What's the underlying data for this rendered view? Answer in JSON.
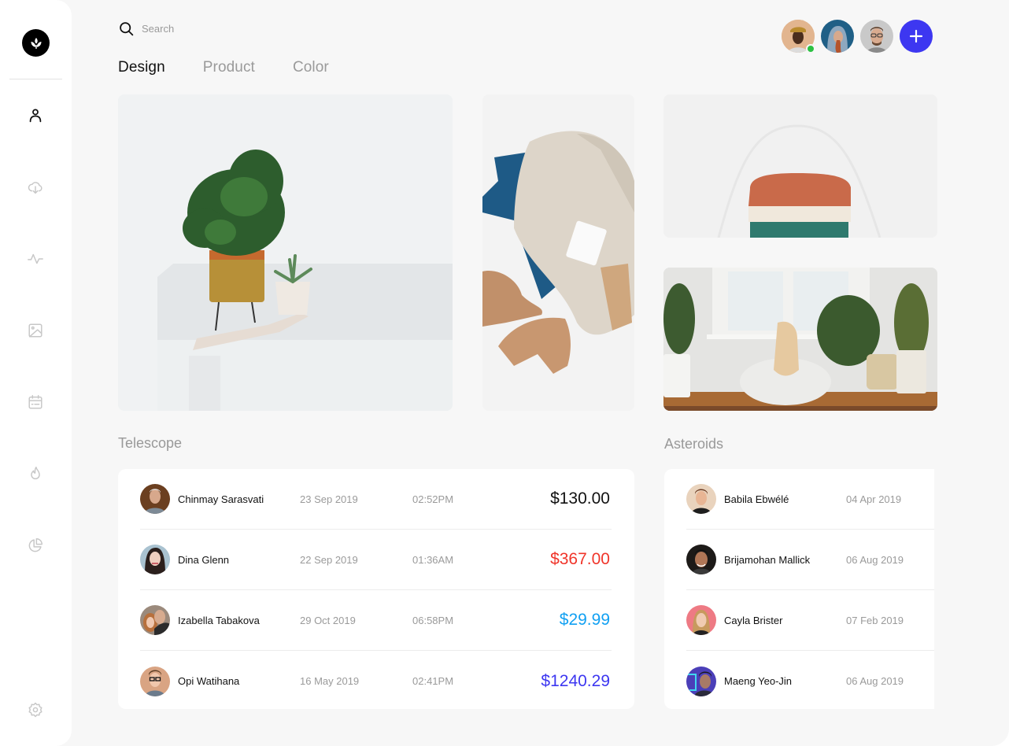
{
  "sidebar": {
    "logo": "leaf-logo-icon",
    "items": [
      {
        "icon": "user-icon",
        "active": true
      },
      {
        "icon": "cloud-download-icon",
        "active": false
      },
      {
        "icon": "activity-icon",
        "active": false
      },
      {
        "icon": "image-icon",
        "active": false
      },
      {
        "icon": "calendar-icon",
        "active": false
      },
      {
        "icon": "fire-icon",
        "active": false
      },
      {
        "icon": "pie-chart-icon",
        "active": false
      }
    ],
    "footer_icon": "settings-icon"
  },
  "search": {
    "placeholder": "Search",
    "value": ""
  },
  "tabs": [
    {
      "label": "Design",
      "active": true
    },
    {
      "label": "Product",
      "active": false
    },
    {
      "label": "Color",
      "active": false
    }
  ],
  "collaborators": [
    {
      "name": "collaborator-1",
      "online": true
    },
    {
      "name": "collaborator-2",
      "online": false
    },
    {
      "name": "collaborator-3",
      "online": false
    }
  ],
  "add_button_icon": "plus-icon",
  "gallery": [
    {
      "subject": "potted plants on white table"
    },
    {
      "subject": "jeans, sweater, boots and mug flat lay"
    },
    {
      "subject": "stacked knit sweaters"
    },
    {
      "subject": "dog on bed in plant-filled room"
    }
  ],
  "telescope": {
    "title": "Telescope",
    "rows": [
      {
        "name": "Chinmay Sarasvati",
        "date": "23 Sep 2019",
        "time": "02:52PM",
        "amount": "$130.00",
        "amount_color": "#111111"
      },
      {
        "name": "Dina Glenn",
        "date": "22 Sep 2019",
        "time": "01:36AM",
        "amount": "$367.00",
        "amount_color": "#f0352a"
      },
      {
        "name": "Izabella Tabakova",
        "date": "29 Oct 2019",
        "time": "06:58PM",
        "amount": "$29.99",
        "amount_color": "#11a0f2"
      },
      {
        "name": "Opi Watihana",
        "date": "16 May 2019",
        "time": "02:41PM",
        "amount": "$1240.29",
        "amount_color": "#3d37f1"
      }
    ]
  },
  "asteroids": {
    "title": "Asteroids",
    "rows": [
      {
        "name": "Babila Ebwélé",
        "date": "04 Apr 2019"
      },
      {
        "name": "Brijamohan Mallick",
        "date": "06 Aug 2019"
      },
      {
        "name": "Cayla Brister",
        "date": "07 Feb 2019"
      },
      {
        "name": "Maeng Yeo-Jin",
        "date": "06 Aug 2019"
      }
    ]
  },
  "colors": {
    "accent": "#3d37f1",
    "online": "#2bc142",
    "background": "#f7f7f7"
  }
}
